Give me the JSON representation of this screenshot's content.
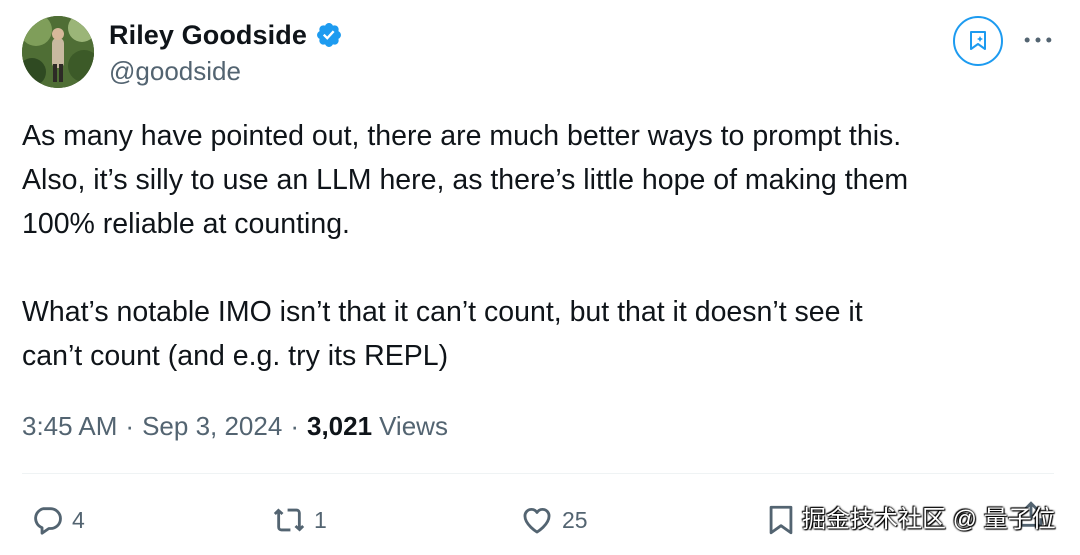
{
  "author": {
    "display_name": "Riley Goodside",
    "handle": "@goodside",
    "avatar_icon": "avatar-photo",
    "verified_color": "#1d9bf0"
  },
  "tweet": {
    "paragraph1": [
      "As many have pointed out, there are much better ways to prompt this.",
      "Also, it’s silly to use an LLM here, as there’s little hope of making them",
      "100% reliable at counting."
    ],
    "paragraph2": [
      "What’s notable IMO isn’t that it can’t count, but that it doesn’t see it",
      "can’t count (and e.g. try its REPL)"
    ]
  },
  "meta": {
    "time": "3:45 AM",
    "separator": "·",
    "date": "Sep 3, 2024",
    "views_count": "3,021",
    "views_label": "Views"
  },
  "actions": {
    "reply_count": "4",
    "repost_count": "1",
    "like_count": "25"
  },
  "watermark": {
    "text": "掘金技术社区 @ 量子位"
  },
  "colors": {
    "accent": "#1d9bf0",
    "text_primary": "#0f1419",
    "text_secondary": "#536471",
    "divider": "#eff3f4"
  }
}
